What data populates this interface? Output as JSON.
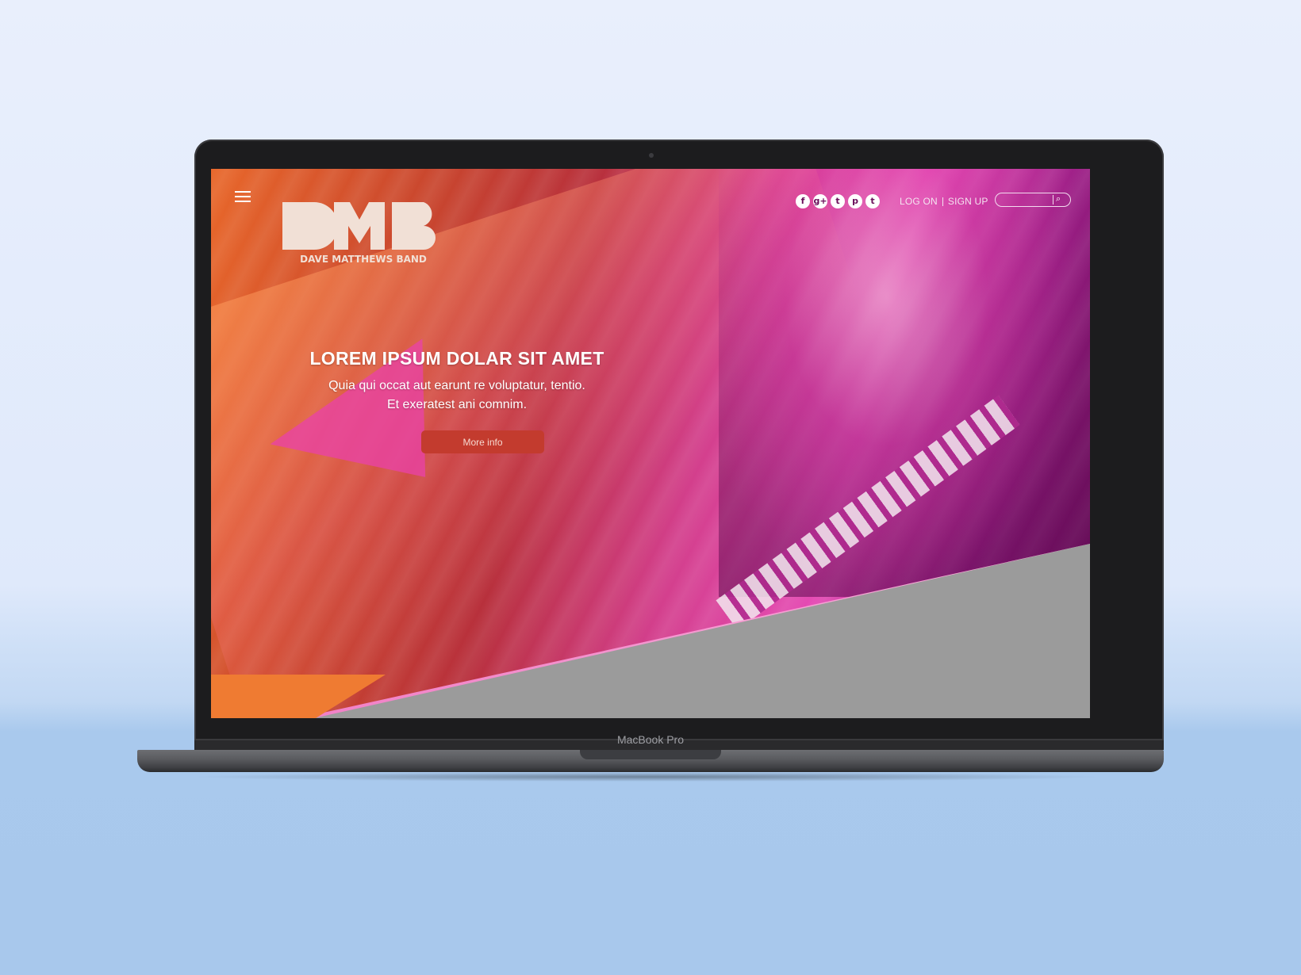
{
  "device": {
    "brand_label": "MacBook Pro"
  },
  "site": {
    "logo": {
      "monogram": "DMB",
      "name": "DAVE MATTHEWS BAND"
    },
    "menu_icon": "hamburger-icon",
    "social": [
      {
        "name": "facebook-icon",
        "glyph": "f"
      },
      {
        "name": "google-plus-icon",
        "glyph": "g+"
      },
      {
        "name": "tumblr-icon",
        "glyph": "t"
      },
      {
        "name": "pinterest-icon",
        "glyph": "p"
      },
      {
        "name": "twitter-icon",
        "glyph": "🐦"
      }
    ],
    "auth": {
      "login": "LOG ON",
      "signup": "SIGN UP"
    },
    "search": {
      "placeholder": ""
    },
    "hero": {
      "headline": "LOREM IPSUM DOLAR SIT AMET",
      "subtext_line1": "Quia qui occat aut earunt re voluptatur, tentio.",
      "subtext_line2": "Et exeratest ani comnim.",
      "cta_label": "More info"
    }
  },
  "colors": {
    "accent_orange": "#ef7b32",
    "accent_pink": "#e54bb4",
    "accent_purple": "#6a0d5a",
    "cta_red": "#c33b2e",
    "band_grey": "#9b9b9b"
  }
}
